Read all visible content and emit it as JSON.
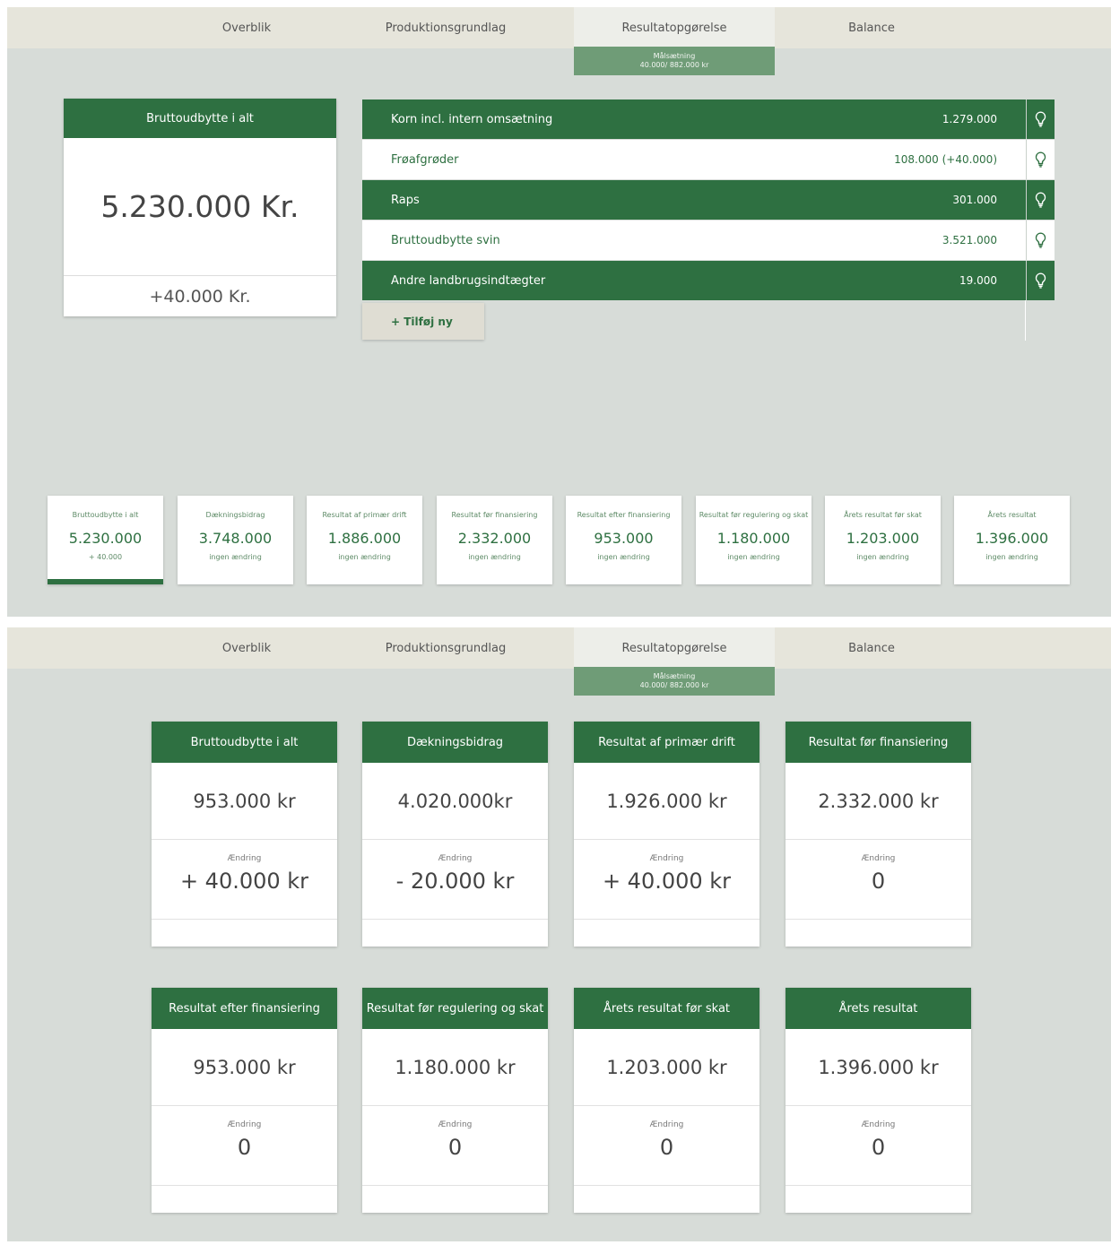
{
  "nav": {
    "tabs": [
      "Overblik",
      "Produktionsgrundlag",
      "Resultatopgørelse",
      "Balance"
    ],
    "active": "Resultatopgørelse",
    "goal_label": "Målsætning",
    "goal_value": "40.000/ 882.000 kr"
  },
  "revenue": {
    "card": {
      "title": "Bruttoudbytte i alt",
      "value": "5.230.000 Kr.",
      "change": "+40.000 Kr."
    },
    "rows": [
      {
        "label": "Korn incl. intern omsætning",
        "value": "1.279.000"
      },
      {
        "label": "Frøafgrøder",
        "value": "108.000 (+40.000)"
      },
      {
        "label": "Raps",
        "value": "301.000"
      },
      {
        "label": "Bruttoudbytte svin",
        "value": "3.521.000"
      },
      {
        "label": "Andre landbrugsindtægter",
        "value": "19.000"
      }
    ],
    "add_label": "+ Tilføj ny"
  },
  "summary": [
    {
      "title": "Bruttoudbytte i alt",
      "value": "5.230.000",
      "change": "+ 40.000"
    },
    {
      "title": "Dækningsbidrag",
      "value": "3.748.000",
      "change": "ingen ændring"
    },
    {
      "title": "Resultat af primær drift",
      "value": "1.886.000",
      "change": "ingen ændring"
    },
    {
      "title": "Resultat før finansiering",
      "value": "2.332.000",
      "change": "ingen ændring"
    },
    {
      "title": "Resultat efter finansiering",
      "value": "953.000",
      "change": "ingen ændring"
    },
    {
      "title": "Resultat før regulering og skat",
      "value": "1.180.000",
      "change": "ingen ændring"
    },
    {
      "title": "Årets resultat før skat",
      "value": "1.203.000",
      "change": "ingen ændring"
    },
    {
      "title": "Årets resultat",
      "value": "1.396.000",
      "change": "ingen ændring"
    }
  ],
  "cards": [
    {
      "title": "Bruttoudbytte i alt",
      "value": "953.000 kr",
      "change_label": "Ændring",
      "change": "+ 40.000 kr"
    },
    {
      "title": "Dækningsbidrag",
      "value": "4.020.000kr",
      "change_label": "Ændring",
      "change": "- 20.000 kr"
    },
    {
      "title": "Resultat af primær drift",
      "value": "1.926.000 kr",
      "change_label": "Ændring",
      "change": "+ 40.000 kr"
    },
    {
      "title": "Resultat før finansiering",
      "value": "2.332.000 kr",
      "change_label": "Ændring",
      "change": "0"
    },
    {
      "title": "Resultat efter finansiering",
      "value": "953.000 kr",
      "change_label": "Ændring",
      "change": "0"
    },
    {
      "title": "Resultat før regulering og skat",
      "value": "1.180.000 kr",
      "change_label": "Ændring",
      "change": "0"
    },
    {
      "title": "Årets resultat før skat",
      "value": "1.203.000 kr",
      "change_label": "Ændring",
      "change": "0"
    },
    {
      "title": "Årets resultat",
      "value": "1.396.000 kr",
      "change_label": "Ændring",
      "change": "0"
    }
  ],
  "colors": {
    "brand_green": "#2e7041",
    "goal_green": "#6f9c77",
    "background": "#d7dcd8",
    "nav_bg": "#e6e5db"
  },
  "icons": {
    "tip": "lightbulb-icon"
  }
}
